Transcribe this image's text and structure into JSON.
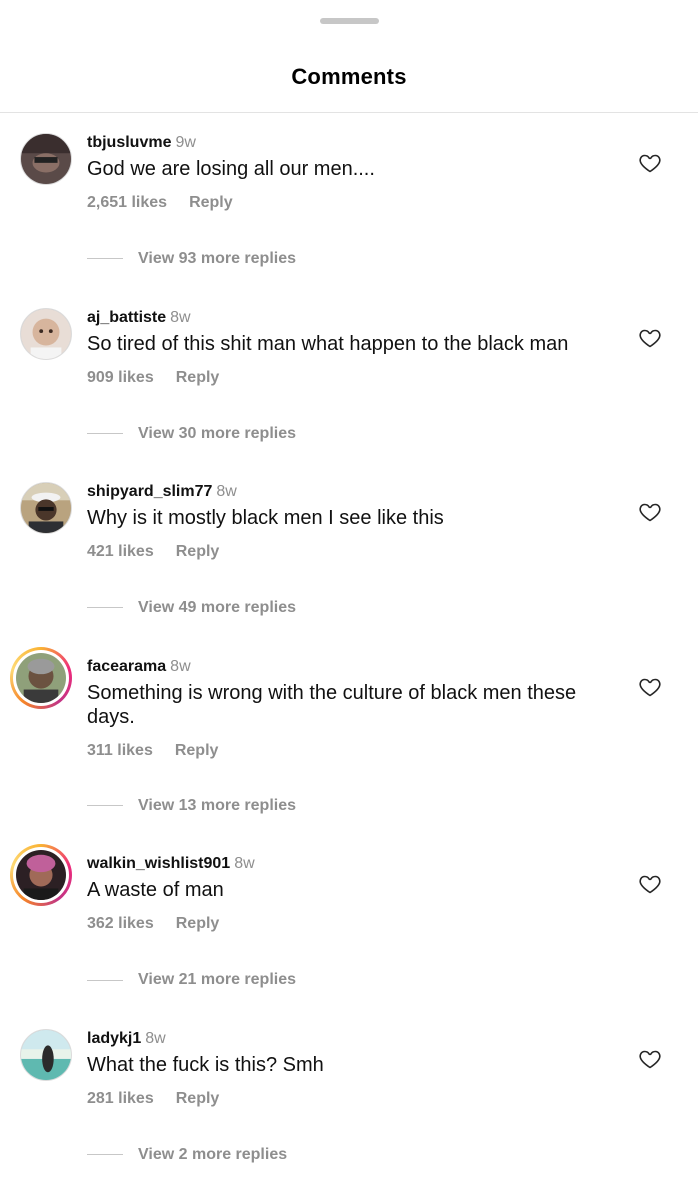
{
  "header": {
    "title": "Comments"
  },
  "comments": [
    {
      "username": "tbjusluvme",
      "time": "9w",
      "text": "God we are losing all our men....",
      "likes": "2,651 likes",
      "reply": "Reply",
      "view_more": "View 93 more replies",
      "avatar_color": "#4a3a3a",
      "story_ring": false
    },
    {
      "username": "aj_battiste",
      "time": "8w",
      "text": "So tired of this shit man what happen to the black man",
      "likes": "909 likes",
      "reply": "Reply",
      "view_more": "View 30 more replies",
      "avatar_color": "#d9c1b0",
      "story_ring": false
    },
    {
      "username": "shipyard_slim77",
      "time": "8w",
      "text": "Why is it mostly black men I see like this",
      "likes": "421 likes",
      "reply": "Reply",
      "view_more": "View 49 more replies",
      "avatar_color": "#7a6a55",
      "story_ring": false
    },
    {
      "username": "facearama",
      "time": "8w",
      "text": "Something is wrong with the culture of black men these days.",
      "likes": "311 likes",
      "reply": "Reply",
      "view_more": "View 13 more replies",
      "avatar_color": "#6d5b48",
      "story_ring": true
    },
    {
      "username": "walkin_wishlist901",
      "time": "8w",
      "text": "A waste of man",
      "likes": "362 likes",
      "reply": "Reply",
      "view_more": "View 21 more replies",
      "avatar_color": "#3d2a2e",
      "story_ring": true
    },
    {
      "username": "ladykj1",
      "time": "8w",
      "text": "What the fuck is this? Smh",
      "likes": "281 likes",
      "reply": "Reply",
      "view_more": "View 2 more replies",
      "avatar_color": "#5aa7a0",
      "story_ring": false
    }
  ],
  "icons": {
    "like": "heart-outline-icon"
  },
  "colors": {
    "secondary_text": "#8e8e8e",
    "divider": "#e3e3e3"
  }
}
